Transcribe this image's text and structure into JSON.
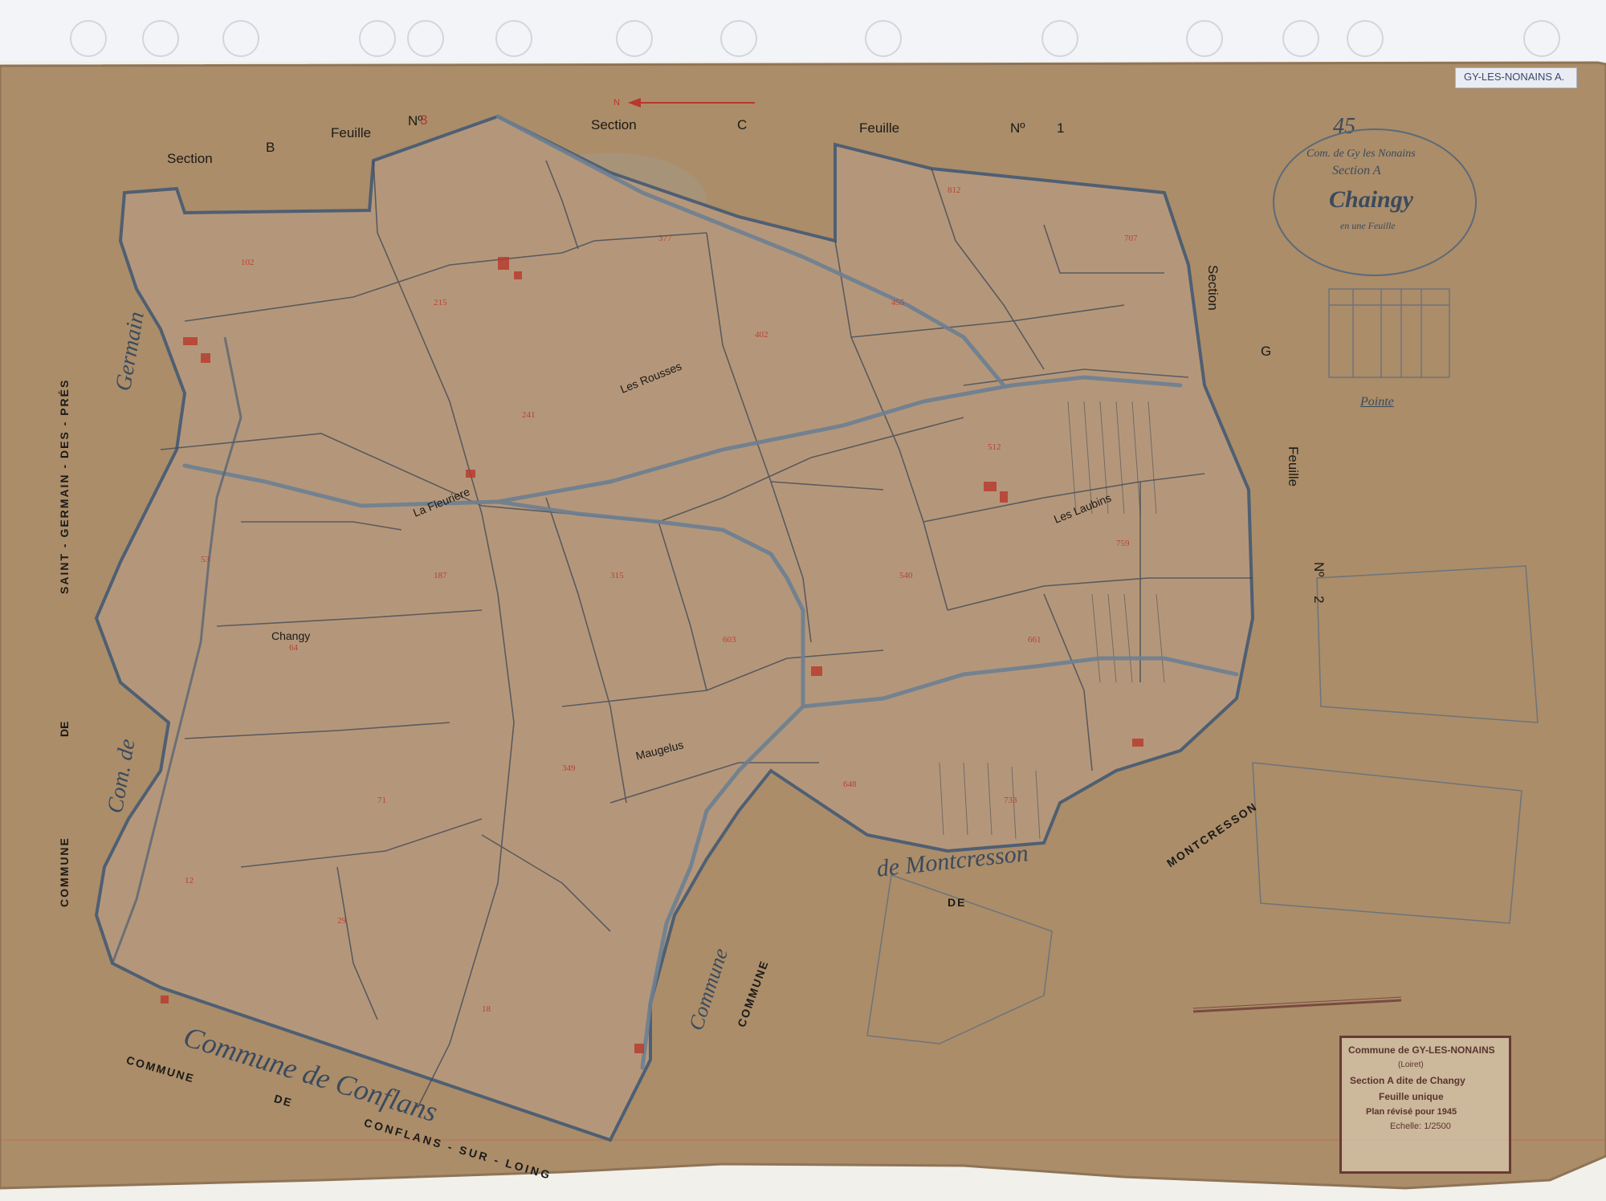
{
  "top_labels": {
    "section_b": "Section",
    "b_letter": "B",
    "feuille_3": "Feuille",
    "no_3": "Nº",
    "num_3": "3",
    "section_c": "Section",
    "c_letter": "C",
    "feuille_1": "Feuille",
    "no_1": "Nº",
    "num_1": "1"
  },
  "right_labels": {
    "section_g": "Section",
    "g_letter": "G",
    "feuille_2": "Feuille",
    "no_2": "Nº",
    "num_2": "2"
  },
  "commune_labels": {
    "left_commune": "COMMUNE",
    "left_de": "DE",
    "saint_germain": "SAINT - GERMAIN - DES - PRÉS",
    "bottom_commune": "COMMUNE",
    "bottom_de": "DE",
    "conflans_sur_loing": "CONFLANS - SUR - LOING",
    "commune_right": "COMMUNE",
    "de_right": "DE",
    "montcresson": "MONTCRESSON"
  },
  "place_names": {
    "changy": "Changy",
    "la_fleuriere": "La Fleuriere",
    "les_rousses": "Les Rousses",
    "les_laubins": "Les Laubins",
    "maugelus": "Maugelus"
  },
  "handwritten": {
    "sheet_number": "45",
    "oval_line1": "Com. de Gy les Nonains",
    "oval_line2": "Section A",
    "oval_title": "Chaingy",
    "oval_line3": "en une Feuille",
    "pointe": "Pointe",
    "commune_de_conflans": "Commune de Conflans",
    "commune_de_montcresson": "de Montcresson",
    "com_left": "Com. de",
    "germain": "Germain",
    "commune_mid": "Commune"
  },
  "folder_tab": "GY-LES-NONAINS  A.",
  "cartouche": {
    "commune_line": "Commune de GY-LES-NONAINS",
    "dept": "(Loiret)",
    "section_line": "Section A dite de Changy",
    "feuille": "Feuille unique",
    "plan": "Plan révisé pour 1945",
    "echelle": "Echelle: 1/2500"
  },
  "north_arrow": "N",
  "colors": {
    "paper": "#a98c68",
    "road": "#6d7f92",
    "ink_red": "#b9372c",
    "ink": "#2c2a27"
  }
}
